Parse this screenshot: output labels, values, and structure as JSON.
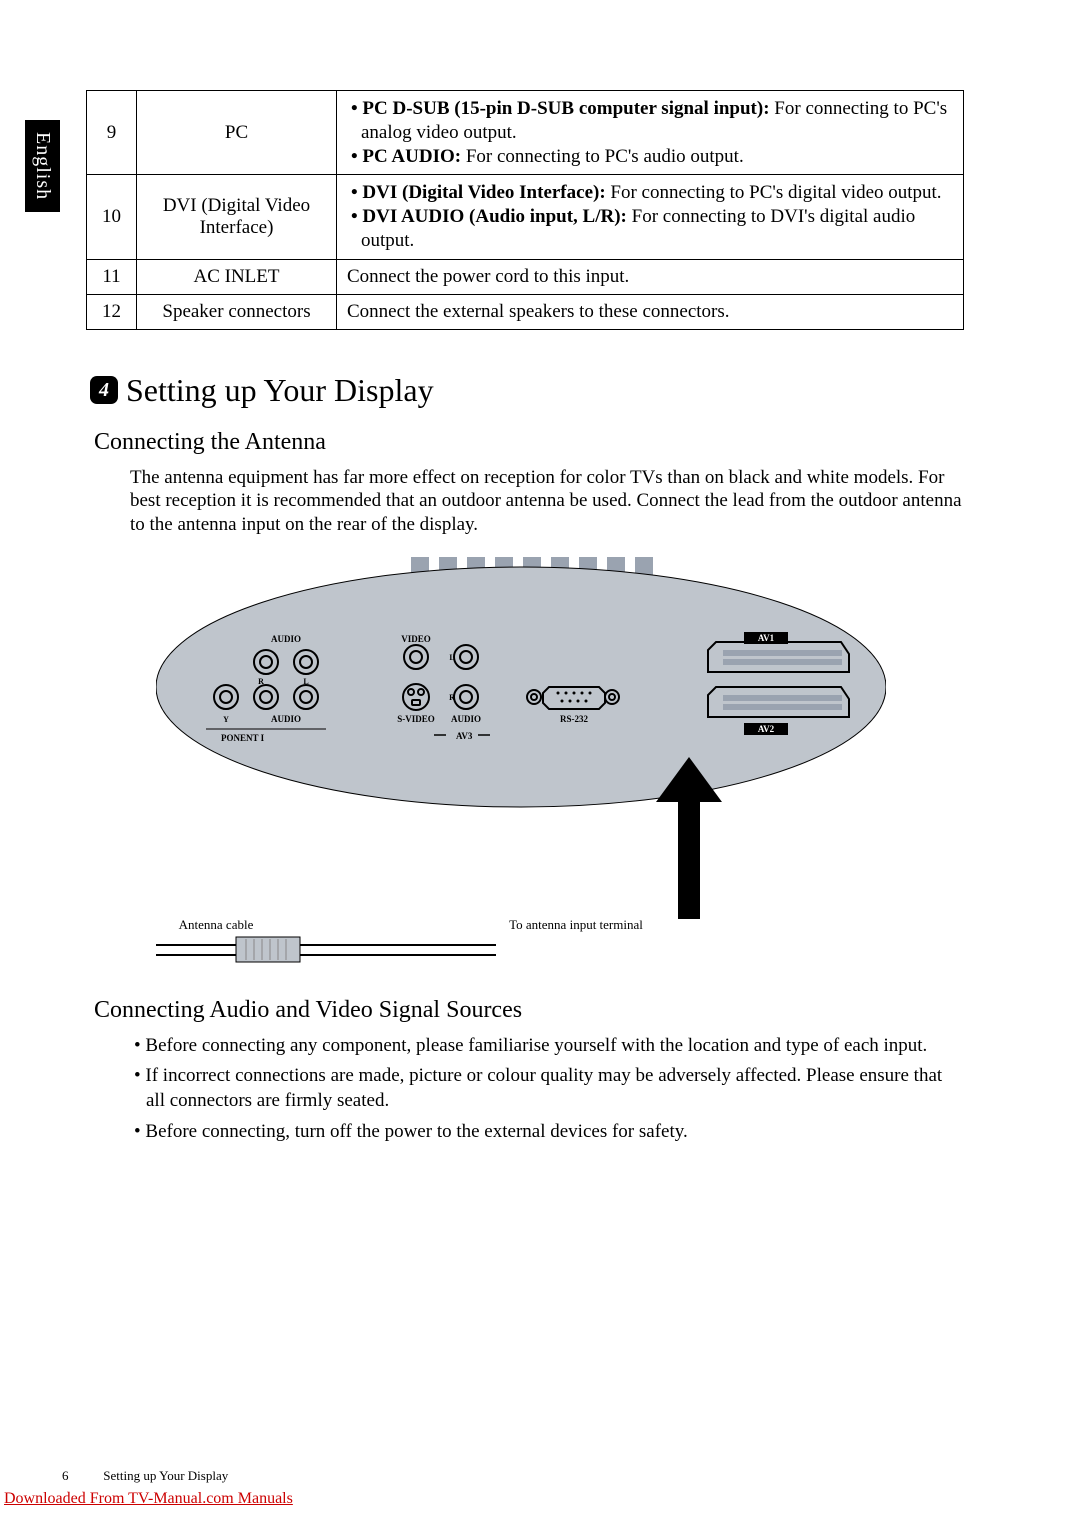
{
  "sideTab": "English",
  "table": {
    "rows": [
      {
        "num": "9",
        "name": "PC",
        "desc": [
          {
            "bold": "PC D-SUB (15-pin D-SUB computer signal input):",
            "rest": " For connecting to PC's analog video output."
          },
          {
            "bold": "PC AUDIO:",
            "rest": " For connecting to PC's audio output."
          }
        ]
      },
      {
        "num": "10",
        "name": "DVI (Digital Video Interface)",
        "desc": [
          {
            "bold": "DVI (Digital Video Interface):",
            "rest": " For connecting to PC's digital video output."
          },
          {
            "bold": "DVI AUDIO (Audio input, L/R):",
            "rest": " For connecting to DVI's digital audio output."
          }
        ]
      },
      {
        "num": "11",
        "name": "AC INLET",
        "descPlain": "Connect the power cord to this input."
      },
      {
        "num": "12",
        "name": "Speaker connectors",
        "descPlain": "Connect the external speakers to these connectors."
      }
    ]
  },
  "section": {
    "badge": "4",
    "title": "Setting up Your Display"
  },
  "sub1": {
    "title": "Connecting the Antenna",
    "para": "The antenna equipment has far more effect on reception for color TVs than on black and white models. For best reception it is recommended that an outdoor antenna be used. Connect the lead from the outdoor antenna to the antenna input on the rear of the display."
  },
  "diagram": {
    "labels": {
      "audio": "AUDIO",
      "video": "VIDEO",
      "l": "L",
      "r": "R",
      "y": "Y",
      "ponent": "PONENT I",
      "svideo": "S-VIDEO",
      "av3": "AV3",
      "rs232": "RS-232",
      "av1": "AV1",
      "av2": "AV2"
    },
    "antennaCable": "Antenna cable",
    "toAntenna": "To antenna input terminal"
  },
  "sub2": {
    "title": "Connecting Audio and Video Signal Sources",
    "bullets": [
      "Before connecting any component, please familiarise yourself with the location and type of each input.",
      "If incorrect connections are made, picture or colour quality may be adversely affected. Please ensure that all connectors are firmly seated.",
      "Before connecting, turn off the power to the external devices for safety."
    ]
  },
  "footer": {
    "pageNum": "6",
    "pageTitle": "Setting up Your Display"
  },
  "download": "Downloaded From TV-Manual.com Manuals"
}
